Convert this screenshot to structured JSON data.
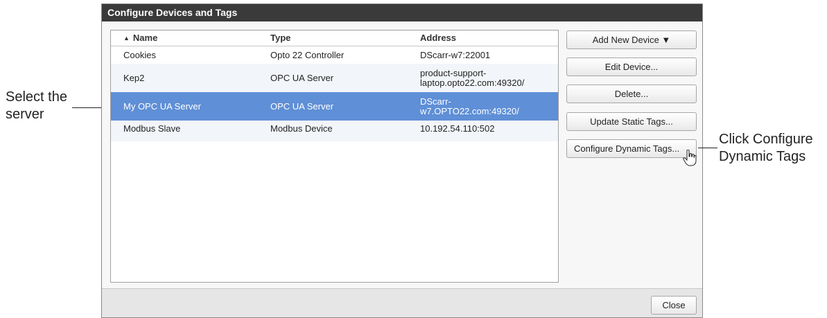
{
  "dialog": {
    "title": "Configure Devices and Tags",
    "table": {
      "sort_indicator": "▲",
      "columns": [
        "Name",
        "Type",
        "Address"
      ],
      "rows": [
        {
          "name": "Cookies",
          "type": "Opto 22 Controller",
          "address_line1": "DScarr-w7:22001",
          "address_line2": ""
        },
        {
          "name": "Kep2",
          "type": "OPC UA Server",
          "address_line1": "product-support-",
          "address_line2": "laptop.opto22.com:49320/"
        },
        {
          "name": "My OPC UA Server",
          "type": "OPC UA Server",
          "address_line1": "DScarr-",
          "address_line2": "w7.OPTO22.com:49320/"
        },
        {
          "name": "Modbus Slave",
          "type": "Modbus Device",
          "address_line1": "10.192.54.110:502",
          "address_line2": ""
        }
      ]
    },
    "buttons": {
      "add_new_device": "Add New Device ▼",
      "edit_device": "Edit Device...",
      "delete": "Delete...",
      "update_static_tags": "Update Static Tags...",
      "configure_dynamic_tags": "Configure Dynamic Tags...",
      "close": "Close"
    }
  },
  "annotations": {
    "left_line1": "Select the",
    "left_line2": "server",
    "right_line1": "Click Configure",
    "right_line2": "Dynamic Tags"
  },
  "colors": {
    "titlebar": "#3a3a3a",
    "selected_row": "#5f8fd6"
  },
  "icons": {
    "cursor": "hand-pointer-icon"
  }
}
